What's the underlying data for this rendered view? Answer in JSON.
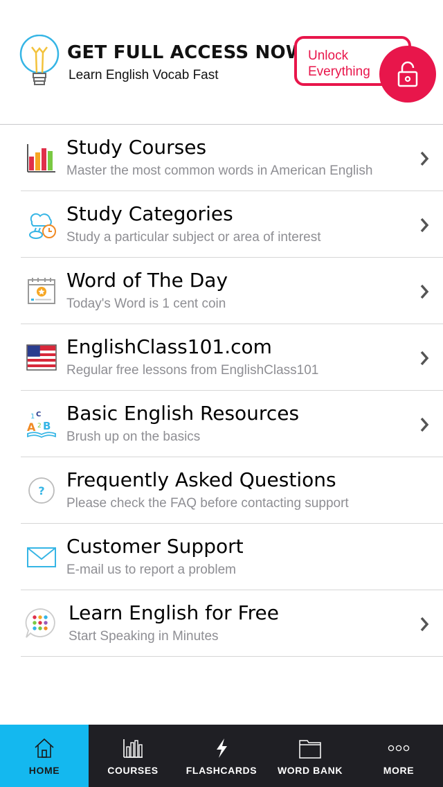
{
  "promo": {
    "title": "GET FULL ACCESS NOW",
    "subtitle": "Learn English Vocab Fast",
    "unlock_label": "Unlock Everything",
    "accent_color": "#e8164b"
  },
  "menu": {
    "items": [
      {
        "icon": "bar-chart-icon",
        "title": "Study Courses",
        "subtitle": "Master the most common words in American English",
        "chevron": true
      },
      {
        "icon": "weather-clock-icon",
        "title": "Study Categories",
        "subtitle": "Study a particular subject or area of interest",
        "chevron": true
      },
      {
        "icon": "calendar-star-icon",
        "title": "Word of The Day",
        "subtitle": "Today's Word is 1 cent coin",
        "chevron": true
      },
      {
        "icon": "us-flag-icon",
        "title": "EnglishClass101.com",
        "subtitle": "Regular free lessons from EnglishClass101",
        "chevron": true
      },
      {
        "icon": "abc-book-icon",
        "title": "Basic English Resources",
        "subtitle": "Brush up on the basics",
        "chevron": true
      },
      {
        "icon": "question-icon",
        "title": "Frequently Asked Questions",
        "subtitle": "Please check the FAQ before contacting support",
        "chevron": false
      },
      {
        "icon": "envelope-icon",
        "title": "Customer Support",
        "subtitle": "E-mail us to report a problem",
        "chevron": false
      },
      {
        "icon": "dots-bubble-icon",
        "title": "Learn English for Free",
        "subtitle": "Start Speaking in Minutes",
        "chevron": true
      }
    ]
  },
  "tabbar": {
    "active_color": "#14b8ef",
    "tabs": [
      {
        "label": "HOME",
        "icon": "home-icon",
        "active": true
      },
      {
        "label": "COURSES",
        "icon": "bar-chart-icon",
        "active": false
      },
      {
        "label": "FLASHCARDS",
        "icon": "lightning-icon",
        "active": false
      },
      {
        "label": "WORD BANK",
        "icon": "folder-icon",
        "active": false
      },
      {
        "label": "MORE",
        "icon": "more-dots-icon",
        "active": false
      }
    ]
  }
}
